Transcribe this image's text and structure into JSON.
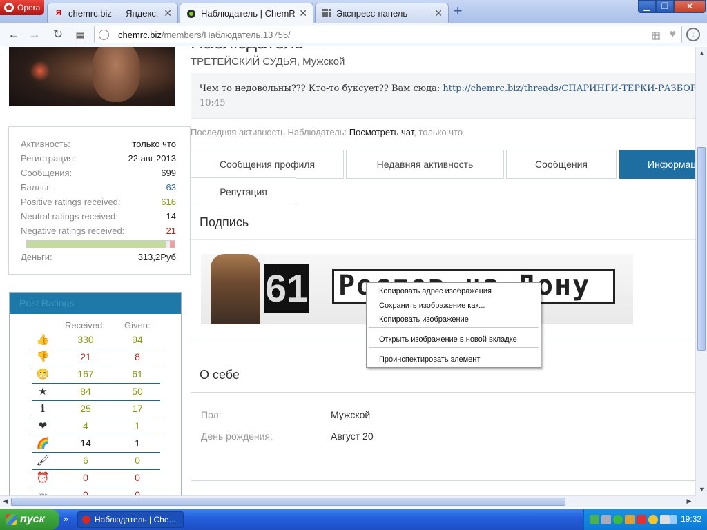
{
  "browser": {
    "app_name": "Opera",
    "tabs": [
      {
        "title": "chemrc.biz — Яндекс: на",
        "favicon": "yandex-icon",
        "active": false
      },
      {
        "title": "Наблюдатель | ChemRc.b",
        "favicon": "chemrc-icon",
        "active": true
      },
      {
        "title": "Экспресс-панель",
        "favicon": "speed-dial-icon",
        "active": false
      }
    ],
    "address": {
      "domain": "chemrc.biz",
      "path": "/members/Наблюдатель.13755/"
    },
    "colors": {
      "frame": "#a9c0ea",
      "close": "#c23f26"
    }
  },
  "profile": {
    "title": "Наблюдатель",
    "subtitle": "ТРЕТЕЙСКИЙ СУДЬЯ, Мужской",
    "status": {
      "text": "Чем то недовольны??? Кто-то буксует?? Вам сюда: ",
      "link": "http://chemrc.biz/threads/СПАРИНГИ-ТЕРКИ-РАЗБОРКИ",
      "time": "10:45"
    },
    "last_activity": {
      "prefix": "Последняя активность Наблюдатель: ",
      "link": "Посмотреть чат",
      "suffix": ", только что"
    },
    "tabs": [
      "Сообщения профиля",
      "Недавняя активность",
      "Сообщения",
      "Информация",
      "Репутация"
    ],
    "active_tab": "Информация"
  },
  "stats": [
    {
      "label": "Активность:",
      "value": "только что",
      "color": "default"
    },
    {
      "label": "Регистрация:",
      "value": "22 авг 2013",
      "color": "default"
    },
    {
      "label": "Сообщения:",
      "value": "699",
      "color": "default"
    },
    {
      "label": "Баллы:",
      "value": "63",
      "color": "blue"
    },
    {
      "label": "Positive ratings received:",
      "value": "616",
      "color": "green"
    },
    {
      "label": "Neutral ratings received:",
      "value": "14",
      "color": "default"
    },
    {
      "label": "Negative ratings received:",
      "value": "21",
      "color": "red"
    },
    {
      "label": "Деньги:",
      "value": "313,2Руб",
      "color": "default"
    }
  ],
  "rating_bar": {
    "positive_fraction": 0.941,
    "negative_fraction": 0.032
  },
  "post_ratings": {
    "title": "Post Ratings",
    "received_label": "Received:",
    "given_label": "Given:",
    "rows": [
      {
        "icon": "thumbs-up-icon",
        "glyph": "👍",
        "received": "330",
        "given": "94",
        "color": "green"
      },
      {
        "icon": "thumbs-down-icon",
        "glyph": "👎",
        "received": "21",
        "given": "8",
        "color": "red"
      },
      {
        "icon": "smile-icon",
        "glyph": "😁",
        "received": "167",
        "given": "61",
        "color": "green"
      },
      {
        "icon": "medal-icon",
        "glyph": "★",
        "received": "84",
        "given": "50",
        "color": "green"
      },
      {
        "icon": "info-icon",
        "glyph": "ℹ",
        "received": "25",
        "given": "17",
        "color": "green"
      },
      {
        "icon": "heart-icon",
        "glyph": "❤",
        "received": "4",
        "given": "1",
        "color": "green"
      },
      {
        "icon": "rainbow-icon",
        "glyph": "🌈",
        "received": "14",
        "given": "1",
        "color": "default"
      },
      {
        "icon": "brush-icon",
        "glyph": "🖌",
        "received": "6",
        "given": "0",
        "color": "green"
      },
      {
        "icon": "alarm-icon",
        "glyph": "⏰",
        "received": "0",
        "given": "0",
        "color": "red"
      },
      {
        "icon": "abc-icon",
        "glyph": "abc",
        "received": "0",
        "given": "0",
        "color": "red"
      }
    ]
  },
  "signature": {
    "heading": "Подпись",
    "banner_number": "61",
    "banner_text": "Ростов на Дону"
  },
  "about": {
    "heading": "О себе",
    "fields": [
      {
        "label": "Пол:",
        "value": "Мужской"
      },
      {
        "label": "День рождения:",
        "value": "Август 20"
      }
    ]
  },
  "context_menu": {
    "items": [
      "Копировать адрес изображения",
      "Сохранить изображение как...",
      "Копировать изображение",
      "Открыть изображение в новой вкладке",
      "Проинспектировать элемент"
    ]
  },
  "taskbar": {
    "start_label": "пуск",
    "task_title": "Наблюдатель | Che...",
    "clock": "19:32"
  }
}
